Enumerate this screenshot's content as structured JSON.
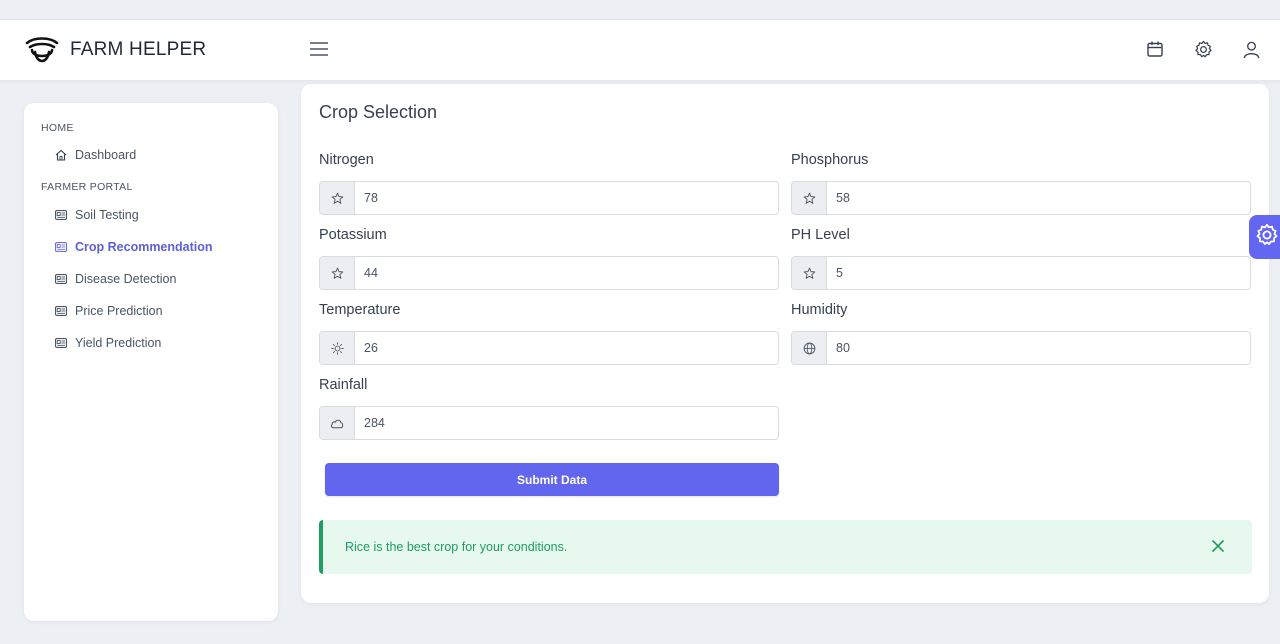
{
  "app": {
    "name": "FARM HELPER"
  },
  "icons": {
    "logo": "farm-logo",
    "menu": "hamburger-menu-icon",
    "calendar": "calendar-icon",
    "settings": "gear-icon",
    "user": "user-icon",
    "nav_home": "home-icon",
    "nav_item": "id-card-icon",
    "close": "close-icon"
  },
  "sidebar": {
    "sections": [
      {
        "title": "HOME",
        "items": [
          {
            "label": "Dashboard",
            "active": false
          }
        ]
      },
      {
        "title": "FARMER PORTAL",
        "items": [
          {
            "label": "Soil Testing",
            "active": false
          },
          {
            "label": "Crop Recommendation",
            "active": true
          },
          {
            "label": "Disease Detection",
            "active": false
          },
          {
            "label": "Price Prediction",
            "active": false
          },
          {
            "label": "Yield Prediction",
            "active": false
          }
        ]
      }
    ]
  },
  "form": {
    "title": "Crop Selection",
    "fields": [
      {
        "label": "Nitrogen",
        "value": "78",
        "icon": "star-icon"
      },
      {
        "label": "Phosphorus",
        "value": "58",
        "icon": "star-icon"
      },
      {
        "label": "Potassium",
        "value": "44",
        "icon": "star-icon"
      },
      {
        "label": "PH Level",
        "value": "5",
        "icon": "star-icon"
      },
      {
        "label": "Temperature",
        "value": "26",
        "icon": "sun-icon"
      },
      {
        "label": "Humidity",
        "value": "80",
        "icon": "globe-icon"
      },
      {
        "label": "Rainfall",
        "value": "284",
        "icon": "cloud-icon"
      }
    ],
    "submit_label": "Submit Data"
  },
  "alert": {
    "message": "Rice is the best crop for your conditions."
  },
  "colors": {
    "accent": "#6366f1",
    "button": "#6265ed",
    "active_nav": "#5d5fd6",
    "success_text": "#1f9d63",
    "success_bg": "#e7f8ef",
    "background": "#eceff4"
  }
}
